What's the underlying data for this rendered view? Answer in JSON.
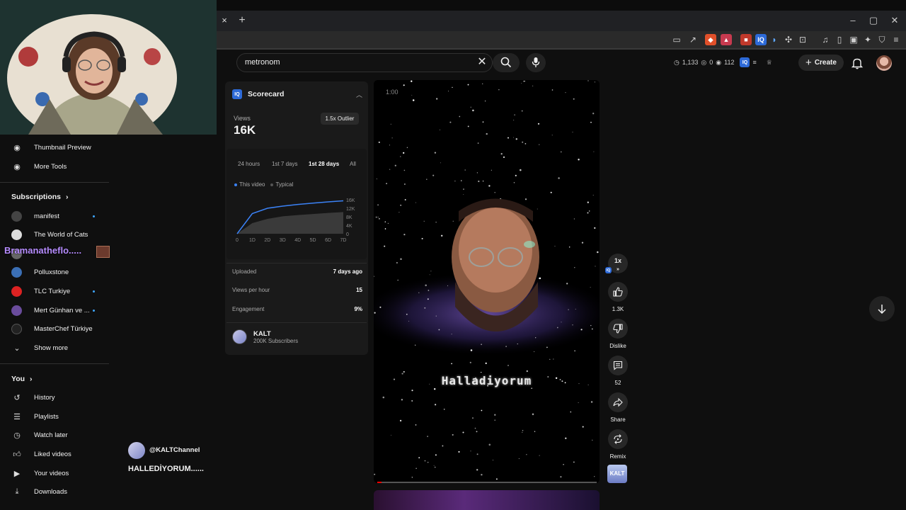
{
  "browser": {
    "tab_close": "×",
    "new_tab": "+",
    "window": {
      "minimize": "–",
      "maximize": "▢",
      "close": "✕"
    }
  },
  "header": {
    "search_query": "metronom",
    "stats": {
      "watch": "1,133",
      "circle": "0",
      "views": "112"
    },
    "create_label": "Create"
  },
  "sidebar": {
    "tools": [
      {
        "label": "Thumbnail Preview"
      },
      {
        "label": "More Tools"
      }
    ],
    "subscriptions_heading": "Subscriptions",
    "subscriptions": [
      {
        "label": "manifest",
        "dot": true
      },
      {
        "label": "The World of Cats",
        "dot": false
      },
      {
        "label": "",
        "dot": false
      },
      {
        "label": "Polluxstone",
        "dot": false
      },
      {
        "label": "TLC Turkiye",
        "dot": true
      },
      {
        "label": "Mert Günhan ve ...",
        "dot": true
      },
      {
        "label": "MasterChef Türkiye",
        "dot": false
      }
    ],
    "show_more": "Show more",
    "you_heading": "You",
    "you_items": [
      {
        "label": "History"
      },
      {
        "label": "Playlists"
      },
      {
        "label": "Watch later"
      },
      {
        "label": "Liked videos"
      },
      {
        "label": "Your videos"
      },
      {
        "label": "Downloads"
      }
    ]
  },
  "overlay": {
    "streamer_name": "Bramanatheflo....."
  },
  "scorecard": {
    "title": "Scorecard",
    "views_label": "Views",
    "views_value": "16K",
    "outlier": "1.5x Outlier",
    "tabs": [
      "24 hours",
      "1st 7 days",
      "1st 28 days",
      "All"
    ],
    "active_tab": "1st 28 days",
    "legend": {
      "this_video": "This video",
      "typical": "Typical"
    },
    "colors": {
      "this_video": "#3b82f6",
      "typical": "#555555"
    },
    "uploaded_label": "Uploaded",
    "uploaded_value": "7 days ago",
    "vph_label": "Views per hour",
    "vph_value": "15",
    "engagement_label": "Engagement",
    "engagement_value": "9%",
    "channel_name": "KALT",
    "channel_subs": "200K Subscribers"
  },
  "chart_data": {
    "type": "line",
    "x": [
      "0",
      "1D",
      "2D",
      "3D",
      "4D",
      "5D",
      "6D",
      "7D"
    ],
    "y_ticks": [
      "16K",
      "12K",
      "8K",
      "4K",
      "0"
    ],
    "ylim": [
      0,
      16000
    ],
    "series": [
      {
        "name": "This video",
        "values": [
          0,
          9500,
          12000,
          13000,
          13800,
          14400,
          15000,
          15500
        ]
      },
      {
        "name": "Typical",
        "values": [
          0,
          5000,
          7000,
          8200,
          8800,
          9300,
          9800,
          10200
        ]
      }
    ]
  },
  "video": {
    "time": "1:00",
    "caption": "Halladiyorum",
    "speed": "1x"
  },
  "actions": {
    "likes": "1.3K",
    "dislike": "Dislike",
    "comments": "52",
    "share": "Share",
    "remix": "Remix",
    "remix_thumb_text": "KALT"
  },
  "channel": {
    "handle": "@KALTChannel",
    "title": "HALLEDİYORUM......"
  }
}
